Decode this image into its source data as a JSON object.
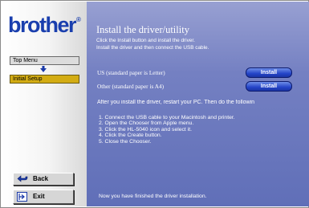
{
  "sidebar": {
    "logo": "brother",
    "logo_mark": "®",
    "menu_top": "Top Menu",
    "menu_current": "Initial Setup",
    "back_label": "Back",
    "exit_label": "Exit"
  },
  "main": {
    "title": "Install the driver/utility",
    "desc_line1": "Click the Install button and install the driver.",
    "desc_line2": "Install the driver and then connect the USB cable.",
    "options": [
      {
        "label": "US (standard paper is Letter)",
        "button": "Install"
      },
      {
        "label": "Other (standard paper is A4)",
        "button": "Install"
      }
    ],
    "after_text": "After you install the driver, restart your PC. Then do the followin",
    "steps": [
      "1. Connect the USB cable to your Macintosh and printer.",
      "2. Open the Chooser from Apple menu.",
      "3. Click the HL-5040 icon and select it.",
      "4. Click the Create button.",
      "5. Close the Chooser."
    ],
    "finished_text": "Now you have finished the driver installation."
  },
  "colors": {
    "logo": "#1a3fae",
    "menu_highlight": "#d3ac13",
    "install_button": "#2444c8",
    "panel_top": "#98a0d2",
    "panel_bottom": "#606fb8"
  }
}
